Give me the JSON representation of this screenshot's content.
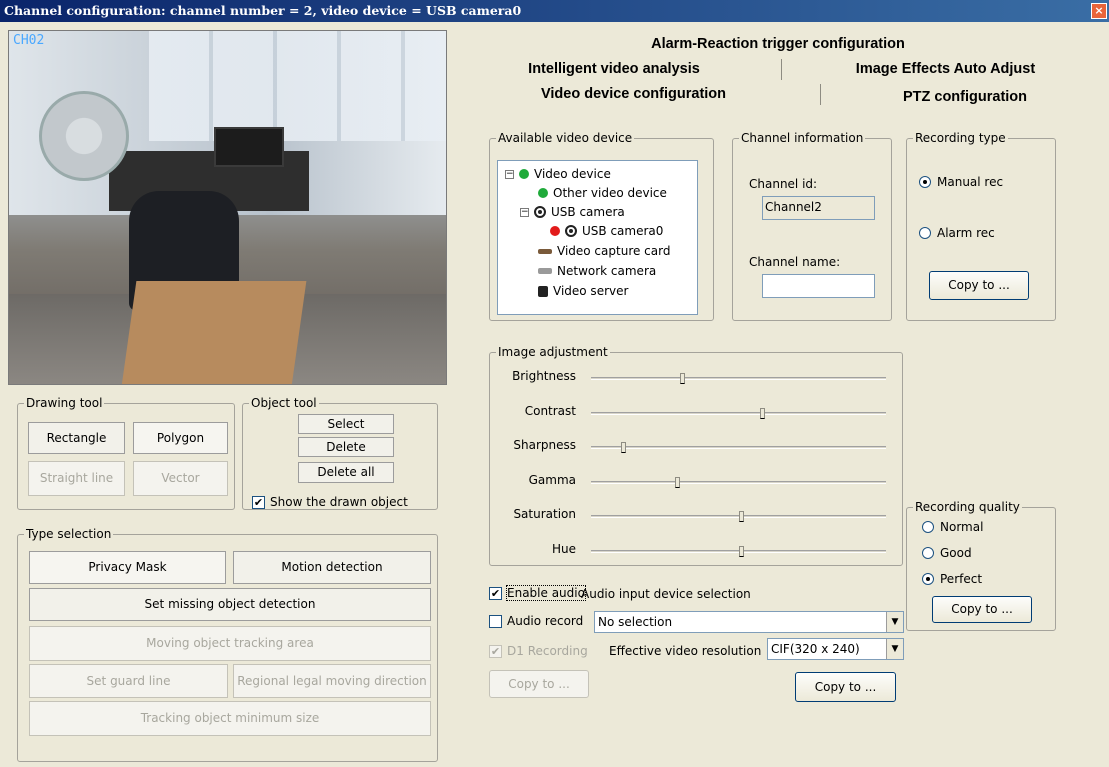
{
  "window": {
    "title": "Channel configuration: channel number = 2, video device = USB camera0",
    "close_glyph": "×"
  },
  "preview": {
    "channel_label": "CH02"
  },
  "drawing_tool": {
    "legend": "Drawing tool",
    "rectangle": "Rectangle",
    "polygon": "Polygon",
    "straight_line": "Straight line",
    "vector": "Vector"
  },
  "object_tool": {
    "legend": "Object tool",
    "select": "Select",
    "delete": "Delete",
    "delete_all": "Delete all",
    "show_drawn": "Show the drawn object",
    "show_drawn_checked": true
  },
  "type_selection": {
    "legend": "Type selection",
    "privacy_mask": "Privacy Mask",
    "motion_detection": "Motion detection",
    "missing_object": "Set missing object detection",
    "tracking_area": "Moving object tracking area",
    "guard_line": "Set guard line",
    "legal_direction": "Regional legal moving direction",
    "min_size": "Tracking object minimum size"
  },
  "tabs": {
    "alarm": "Alarm-Reaction trigger configuration",
    "intelligent": "Intelligent video analysis",
    "image_effects": "Image Effects Auto Adjust",
    "video_device": "Video device configuration",
    "ptz": "PTZ configuration"
  },
  "available_device": {
    "legend": "Available video device",
    "tree": [
      {
        "label": "Video device",
        "expander": "−"
      },
      {
        "label": "Other video device"
      },
      {
        "label": "USB camera",
        "expander": "−"
      },
      {
        "label": "USB camera0"
      },
      {
        "label": "Video capture card"
      },
      {
        "label": "Network camera"
      },
      {
        "label": "Video server"
      }
    ]
  },
  "channel_info": {
    "legend": "Channel information",
    "id_label": "Channel id:",
    "id_value": "Channel2",
    "name_label": "Channel name:",
    "name_value": ""
  },
  "recording_type": {
    "legend": "Recording type",
    "manual": "Manual rec",
    "alarm": "Alarm rec",
    "selected": "manual",
    "copy": "Copy to ..."
  },
  "image_adjustment": {
    "legend": "Image adjustment",
    "sliders": [
      {
        "label": "Brightness",
        "value": 0.31
      },
      {
        "label": "Contrast",
        "value": 0.58
      },
      {
        "label": "Sharpness",
        "value": 0.11
      },
      {
        "label": "Gamma",
        "value": 0.29
      },
      {
        "label": "Saturation",
        "value": 0.51
      },
      {
        "label": "Hue",
        "value": 0.51
      }
    ]
  },
  "recording_quality": {
    "legend": "Recording quality",
    "normal": "Normal",
    "good": "Good",
    "perfect": "Perfect",
    "selected": "perfect",
    "copy": "Copy to ..."
  },
  "audio": {
    "enable": "Enable audio",
    "enable_checked": true,
    "input_device": "Audio input device selection",
    "record": "Audio record",
    "record_checked": false,
    "device_value": "No selection"
  },
  "recording": {
    "d1": "D1 Recording",
    "d1_checked": true,
    "resolution_label": "Effective video resolution",
    "resolution_value": "CIF(320 x 240)",
    "copy_left": "Copy to ...",
    "copy_right": "Copy to ..."
  },
  "glyphs": {
    "check": "✔",
    "dropdown": "▼"
  }
}
